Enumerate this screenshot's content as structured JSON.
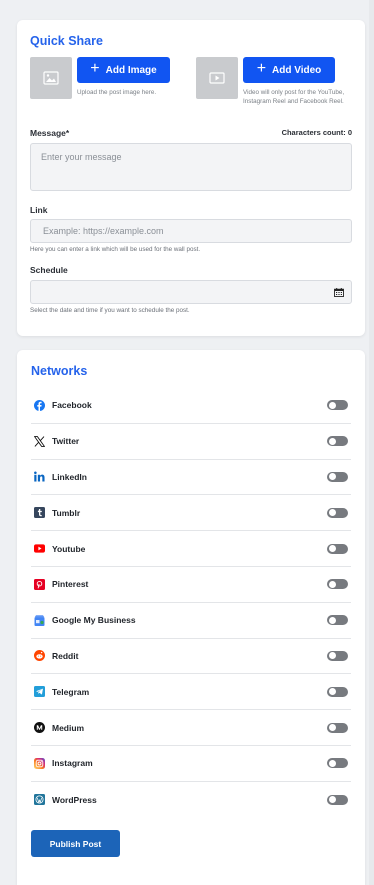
{
  "quick_share": {
    "title": "Quick Share",
    "add_image_label": "Add Image",
    "add_image_hint": "Upload the post image here.",
    "add_video_label": "Add Video",
    "add_video_hint": "Video will only post for the YouTube, Instagram Reel and Facebook Reel.",
    "message_label": "Message*",
    "characters_count": "Characters count: 0",
    "message_placeholder": "Enter your message",
    "message_value": "",
    "link_label": "Link",
    "link_placeholder": "Example: https://example.com",
    "link_value": "",
    "link_help": "Here you can enter a link which will be used for the wall post.",
    "schedule_label": "Schedule",
    "schedule_value": "",
    "schedule_help": "Select the date and time if you want to schedule the post."
  },
  "networks": {
    "title": "Networks",
    "items": [
      {
        "name": "Facebook",
        "icon": "facebook-icon",
        "color": "#1877f2",
        "enabled": false
      },
      {
        "name": "Twitter",
        "icon": "x-twitter-icon",
        "color": "#111111",
        "enabled": false
      },
      {
        "name": "LinkedIn",
        "icon": "linkedin-icon",
        "color": "#0a66c2",
        "enabled": false
      },
      {
        "name": "Tumblr",
        "icon": "tumblr-icon",
        "color": "#36465d",
        "enabled": false
      },
      {
        "name": "Youtube",
        "icon": "youtube-icon",
        "color": "#ff0000",
        "enabled": false
      },
      {
        "name": "Pinterest",
        "icon": "pinterest-icon",
        "color": "#e60023",
        "enabled": false
      },
      {
        "name": "Google My Business",
        "icon": "google-my-business-icon",
        "color": "#4285f4",
        "enabled": false
      },
      {
        "name": "Reddit",
        "icon": "reddit-icon",
        "color": "#ff4500",
        "enabled": false
      },
      {
        "name": "Telegram",
        "icon": "telegram-icon",
        "color": "#229ed9",
        "enabled": false
      },
      {
        "name": "Medium",
        "icon": "medium-icon",
        "color": "#111111",
        "enabled": false
      },
      {
        "name": "Instagram",
        "icon": "instagram-icon",
        "color": "#e1306c",
        "enabled": false
      },
      {
        "name": "WordPress",
        "icon": "wordpress-icon",
        "color": "#21759b",
        "enabled": false
      }
    ]
  },
  "publish_label": "Publish Post",
  "colors": {
    "accent": "#2563eb",
    "add_button": "#1155f2",
    "publish_button": "#1c64b8",
    "toggle_off": "#777a7f"
  }
}
